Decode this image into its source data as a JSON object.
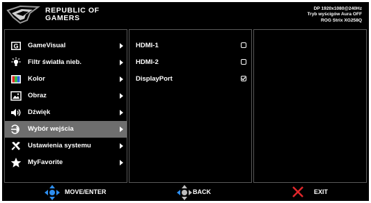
{
  "header": {
    "brand_line1": "REPUBLIC OF",
    "brand_line2": "GAMERS",
    "status_line1": "DP 1920x1080@240Hz",
    "status_line2": "Tryb wyścigów  Aura OFF",
    "status_line3": "ROG Strix XG258Q"
  },
  "main_menu": [
    {
      "label": "GameVisual",
      "icon": "gamevisual-icon",
      "selected": false
    },
    {
      "label": "Filtr światła nieb.",
      "icon": "blue-light-filter-icon",
      "selected": false
    },
    {
      "label": "Kolor",
      "icon": "color-icon",
      "selected": false
    },
    {
      "label": "Obraz",
      "icon": "image-icon",
      "selected": false
    },
    {
      "label": "Dźwięk",
      "icon": "speaker-icon",
      "selected": false
    },
    {
      "label": "Wybór wejścia",
      "icon": "input-select-icon",
      "selected": true
    },
    {
      "label": "Ustawienia systemu",
      "icon": "system-setup-icon",
      "selected": false
    },
    {
      "label": "MyFavorite",
      "icon": "star-icon",
      "selected": false
    }
  ],
  "sub_menu": [
    {
      "label": "HDMI-1",
      "checked": false
    },
    {
      "label": "HDMI-2",
      "checked": false
    },
    {
      "label": "DisplayPort",
      "checked": true
    }
  ],
  "footer": {
    "move_label": "MOVE/ENTER",
    "back_label": "BACK",
    "exit_label": "EXIT"
  },
  "colors": {
    "background": "#000000",
    "selected": "#6e6e6e",
    "divider": "#5a5a5a",
    "dpad": "#2d8ef0",
    "exit_x": "#e0262b"
  }
}
